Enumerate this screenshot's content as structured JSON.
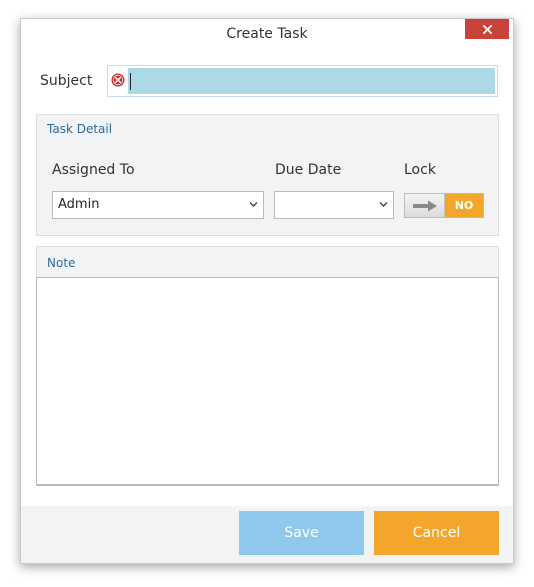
{
  "window": {
    "title": "Create Task",
    "close_symbol": "✕"
  },
  "subject": {
    "label": "Subject",
    "value": "",
    "icon": "error-icon"
  },
  "task_detail": {
    "header": "Task Detail",
    "assigned_to": {
      "label": "Assigned To",
      "value": "Admin"
    },
    "due_date": {
      "label": "Due Date",
      "value": ""
    },
    "lock": {
      "label": "Lock",
      "state": "NO"
    }
  },
  "note": {
    "header": "Note",
    "value": ""
  },
  "footer": {
    "save_label": "Save",
    "cancel_label": "Cancel"
  },
  "colors": {
    "accent_orange": "#f4a62a",
    "save_blue": "#8ec8ea",
    "input_highlight": "#add8e6",
    "close_red": "#c8443a",
    "group_header": "#2d6a9a"
  }
}
